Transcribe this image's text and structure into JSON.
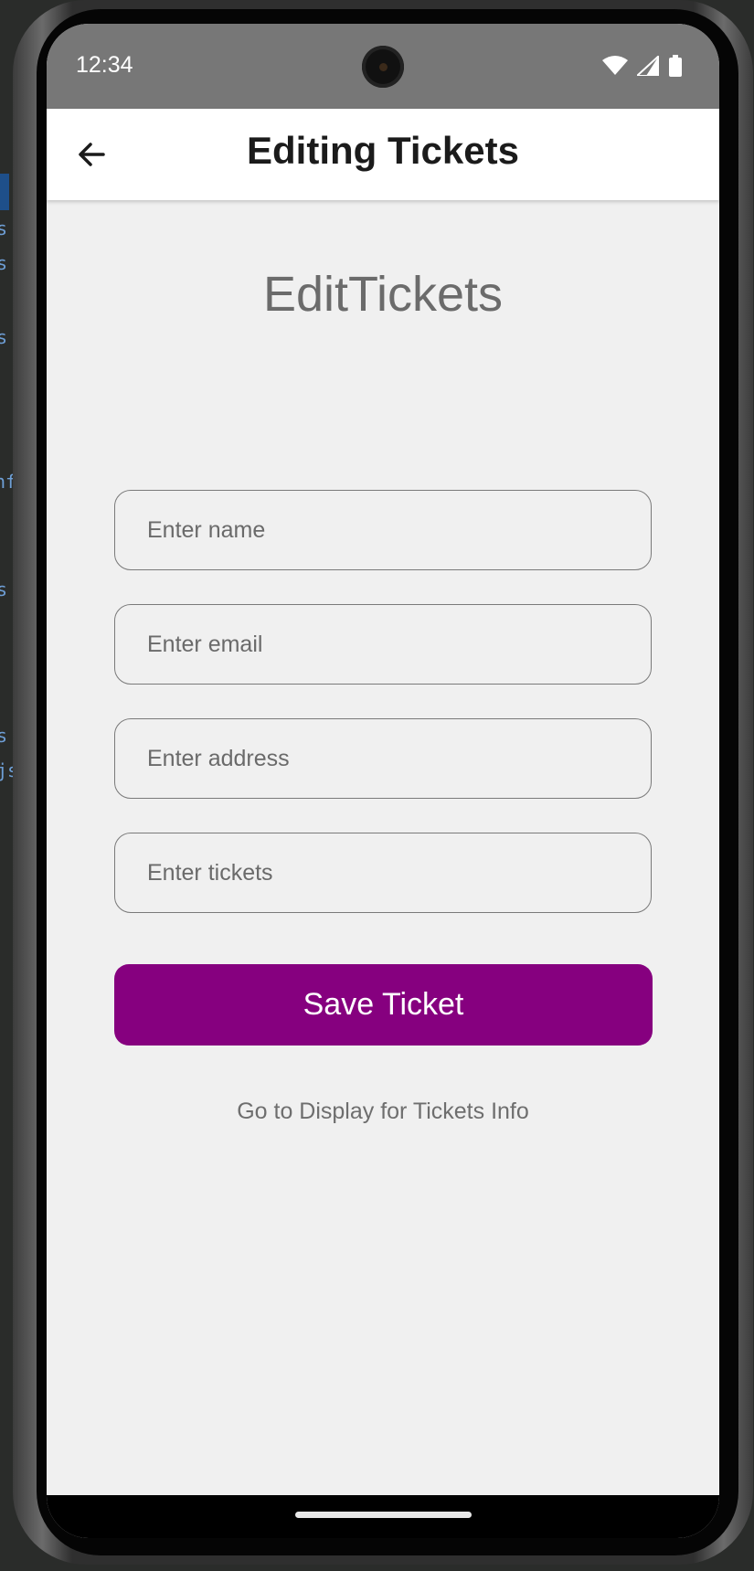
{
  "status_bar": {
    "time": "12:34",
    "icons": [
      "wifi-icon",
      "signal-icon",
      "battery-icon"
    ]
  },
  "app_bar": {
    "title": "Editing Tickets",
    "back_icon": "arrow-back-icon"
  },
  "main": {
    "heading": "EditTickets",
    "fields": {
      "name_placeholder": "Enter name",
      "email_placeholder": "Enter email",
      "address_placeholder": "Enter address",
      "tickets_placeholder": "Enter tickets"
    },
    "save_label": "Save Ticket",
    "link_label": "Go to Display for Tickets Info"
  },
  "colors": {
    "primary": "#86007f",
    "status_bar": "#777777",
    "background": "#f0f0f0"
  }
}
